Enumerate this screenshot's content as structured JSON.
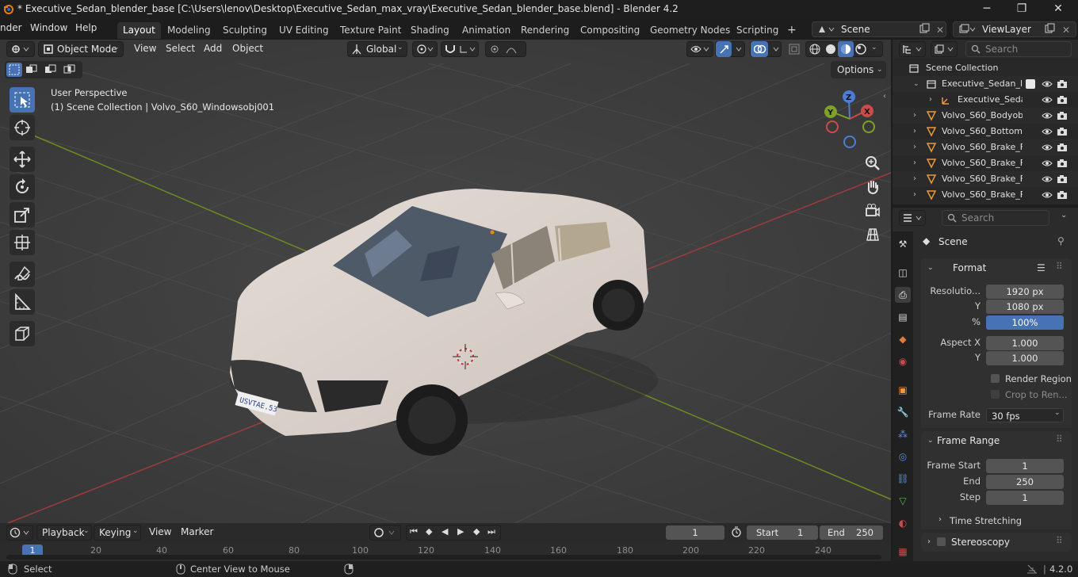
{
  "title_bar": {
    "title": "* Executive_Sedan_blender_base [C:\\Users\\lenov\\Desktop\\Executive_Sedan_max_vray\\Executive_Sedan_blender_base.blend] - Blender 4.2",
    "minimize": "─",
    "maximize": "❐",
    "close": "✕"
  },
  "top_menu": {
    "items": [
      "nder",
      "Window",
      "Help"
    ],
    "workspaces": [
      "Layout",
      "Modeling",
      "Sculpting",
      "UV Editing",
      "Texture Paint",
      "Shading",
      "Animation",
      "Rendering",
      "Compositing",
      "Geometry Nodes",
      "Scripting"
    ],
    "active_workspace": "Layout",
    "add_workspace": "+",
    "scene": "Scene",
    "view_layer": "ViewLayer"
  },
  "viewport": {
    "mode": "Object Mode",
    "menus": [
      "View",
      "Select",
      "Add",
      "Object"
    ],
    "orientation": "Global",
    "options_label": "Options",
    "info_line1": "User Perspective",
    "info_line2": "(1) Scene Collection | Volvo_S60_Windowsobj001",
    "gizmo": {
      "x": "X",
      "y": "Y",
      "z": "Z"
    },
    "license_plate": "USVTAE.53"
  },
  "outliner": {
    "search_placeholder": "Search",
    "rows": [
      {
        "label": "Scene Collection"
      },
      {
        "label": "Executive_Sedan_la"
      },
      {
        "label": "Executive_Seda"
      },
      {
        "label": "Volvo_S60_Bodyob"
      },
      {
        "label": "Volvo_S60_Bottom"
      },
      {
        "label": "Volvo_S60_Brake_F"
      },
      {
        "label": "Volvo_S60_Brake_F"
      },
      {
        "label": "Volvo_S60_Brake_F"
      },
      {
        "label": "Volvo_S60_Brake_F"
      }
    ]
  },
  "properties": {
    "search_placeholder": "Search",
    "context": "Scene",
    "format_panel": {
      "title": "Format",
      "resolution_label": "Resolutio...",
      "res_x": "1920 px",
      "y_label": "Y",
      "res_y": "1080 px",
      "pct_label": "%",
      "res_pct": "100%",
      "aspect_label": "Aspect X",
      "aspect_x": "1.000",
      "aspect_y_label": "Y",
      "aspect_y": "1.000",
      "render_region": "Render Region",
      "crop": "Crop to Ren...",
      "frame_rate_label": "Frame Rate",
      "frame_rate": "30 fps"
    },
    "frame_range_panel": {
      "title": "Frame Range",
      "start_label": "Frame Start",
      "start": "1",
      "end_label": "End",
      "end": "250",
      "step_label": "Step",
      "step": "1",
      "time_stretching": "Time Stretching"
    },
    "stereoscopy": "Stereoscopy"
  },
  "timeline": {
    "menus": [
      "Playback",
      "Keying",
      "View",
      "Marker"
    ],
    "current_frame": "1",
    "start_label": "Start",
    "start": "1",
    "end_label": "End",
    "end": "250",
    "ruler": [
      "1",
      "20",
      "40",
      "60",
      "80",
      "100",
      "120",
      "140",
      "160",
      "180",
      "200",
      "220",
      "240"
    ]
  },
  "status_bar": {
    "select": "Select",
    "center_view": "Center View to Mouse",
    "version": "4.2.0"
  },
  "colors": {
    "accent": "#4772b3",
    "x_axis": "#c94b4b",
    "y_axis": "#7fa12a",
    "z_axis": "#4b7dd6"
  }
}
